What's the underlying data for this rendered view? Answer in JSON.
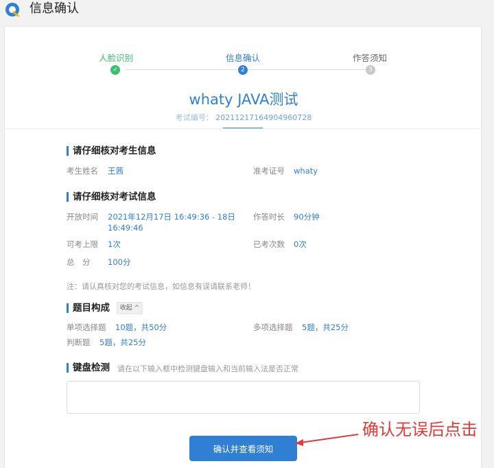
{
  "window": {
    "title": "信息确认"
  },
  "steps": [
    {
      "label": "人脸识别",
      "status": "done",
      "marker": "✓"
    },
    {
      "label": "信息确认",
      "status": "active",
      "marker": "2"
    },
    {
      "label": "作答须知",
      "status": "pending",
      "marker": "3"
    }
  ],
  "colors": {
    "done": "#36c26e",
    "active": "#2f7fd5",
    "pending": "#c8c8c8",
    "annotation": "#e53935"
  },
  "exam": {
    "title": "whaty JAVA测试",
    "code_label": "考试编号：",
    "code_value": "20211217164904960728"
  },
  "candidate_section": {
    "title": "请仔细核对考生信息",
    "name_label": "考生姓名",
    "name_value": "王茜",
    "ticket_label": "准考证号",
    "ticket_value": "whaty"
  },
  "exam_section": {
    "title": "请仔细核对考试信息",
    "open_time_label": "开放时间",
    "open_time_line1": "2021年12月17日 16:49:36 - 18日",
    "open_time_line2": "16:49:46",
    "duration_label": "作答时长",
    "duration_value": "90分钟",
    "max_attempts_label": "可考上限",
    "max_attempts_value": "1次",
    "taken_label": "已考次数",
    "taken_value": "0次",
    "total_label": "总　分",
    "total_value": "100分",
    "note": "注：请认真核对您的考试信息，如信息有误请联系老师！"
  },
  "composition": {
    "title": "题目构成",
    "collapse_label": "收起 ^",
    "items": [
      {
        "label": "单项选择题",
        "value": "10题，共50分"
      },
      {
        "label": "多项选择题",
        "value": "5题，共25分"
      },
      {
        "label": "判断题",
        "value": "5题，共25分"
      }
    ]
  },
  "keyboard": {
    "title": "键盘检测",
    "hint": "请在以下输入框中检测键盘输入和当前输入法是否正常",
    "placeholder": ""
  },
  "confirm_button": "确认并查看须知",
  "annotation": "确认无误后点击"
}
